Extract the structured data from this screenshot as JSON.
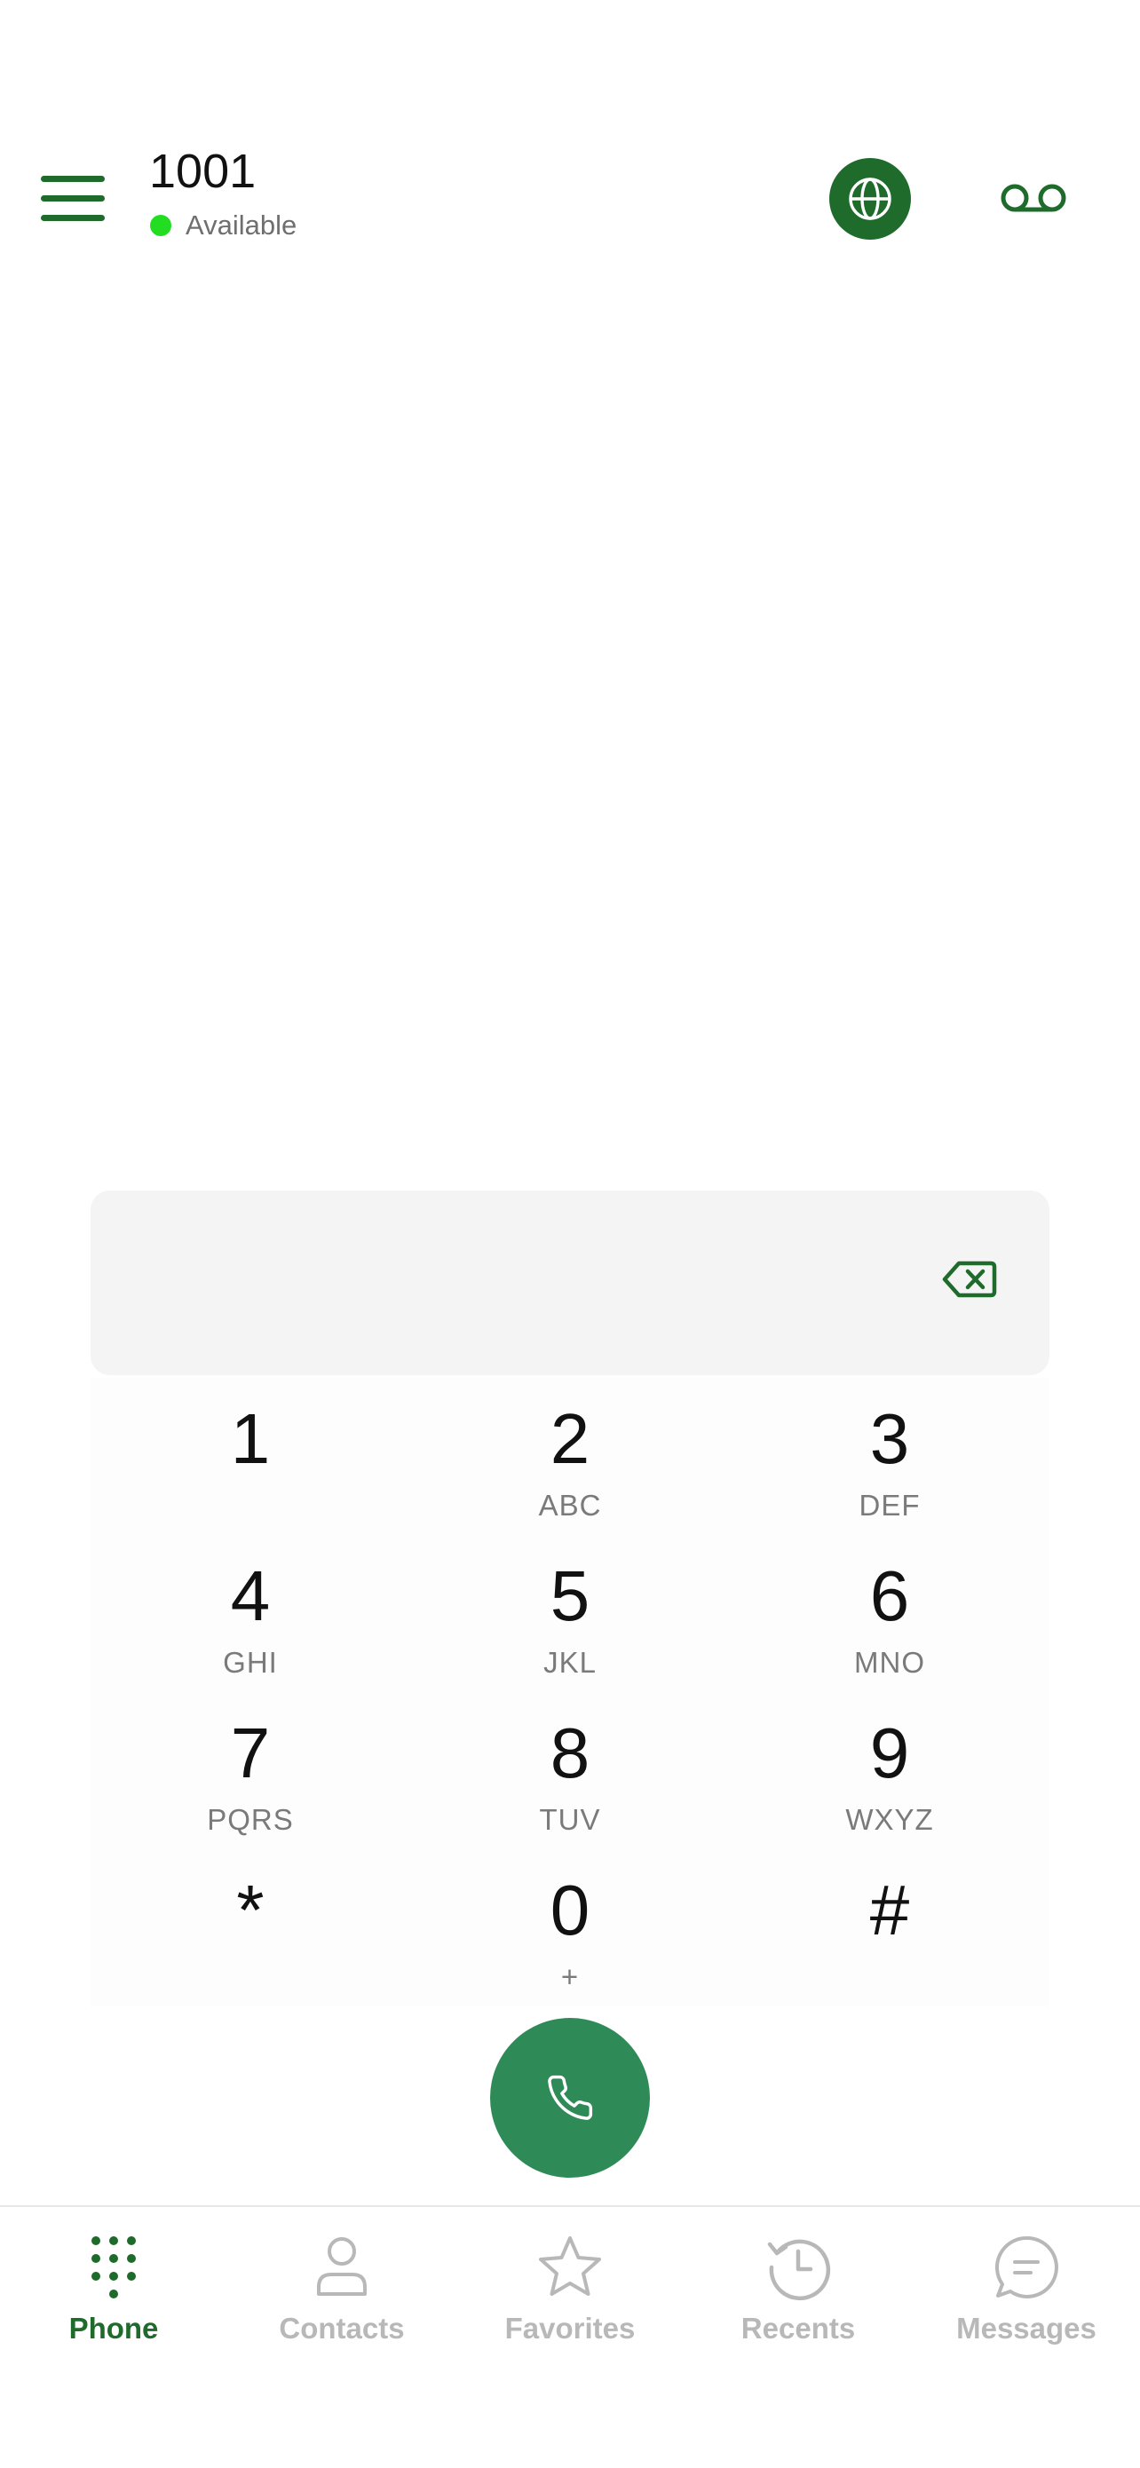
{
  "colors": {
    "brand_green": "#1e6b2c",
    "call_green": "#2e8b57",
    "status_green": "#22dd22",
    "inactive_gray": "#b8b8b8"
  },
  "header": {
    "menu_icon": "hamburger-menu-icon",
    "extension_number": "1001",
    "status_text": "Available",
    "globe_icon": "globe-icon",
    "voicemail_icon": "voicemail-icon"
  },
  "dialer": {
    "input_value": "",
    "backspace_icon": "backspace-icon",
    "keys": [
      {
        "digit": "1",
        "letters": ""
      },
      {
        "digit": "2",
        "letters": "ABC"
      },
      {
        "digit": "3",
        "letters": "DEF"
      },
      {
        "digit": "4",
        "letters": "GHI"
      },
      {
        "digit": "5",
        "letters": "JKL"
      },
      {
        "digit": "6",
        "letters": "MNO"
      },
      {
        "digit": "7",
        "letters": "PQRS"
      },
      {
        "digit": "8",
        "letters": "TUV"
      },
      {
        "digit": "9",
        "letters": "WXYZ"
      },
      {
        "digit": "*",
        "letters": ""
      },
      {
        "digit": "0",
        "letters": "+"
      },
      {
        "digit": "#",
        "letters": ""
      }
    ],
    "call_icon": "phone-handset-icon"
  },
  "bottom_nav": {
    "active_tab": "Phone",
    "tabs": [
      {
        "label": "Phone",
        "icon": "dialpad-icon"
      },
      {
        "label": "Contacts",
        "icon": "person-icon"
      },
      {
        "label": "Favorites",
        "icon": "star-icon"
      },
      {
        "label": "Recents",
        "icon": "history-clock-icon"
      },
      {
        "label": "Messages",
        "icon": "chat-bubble-icon"
      }
    ]
  }
}
